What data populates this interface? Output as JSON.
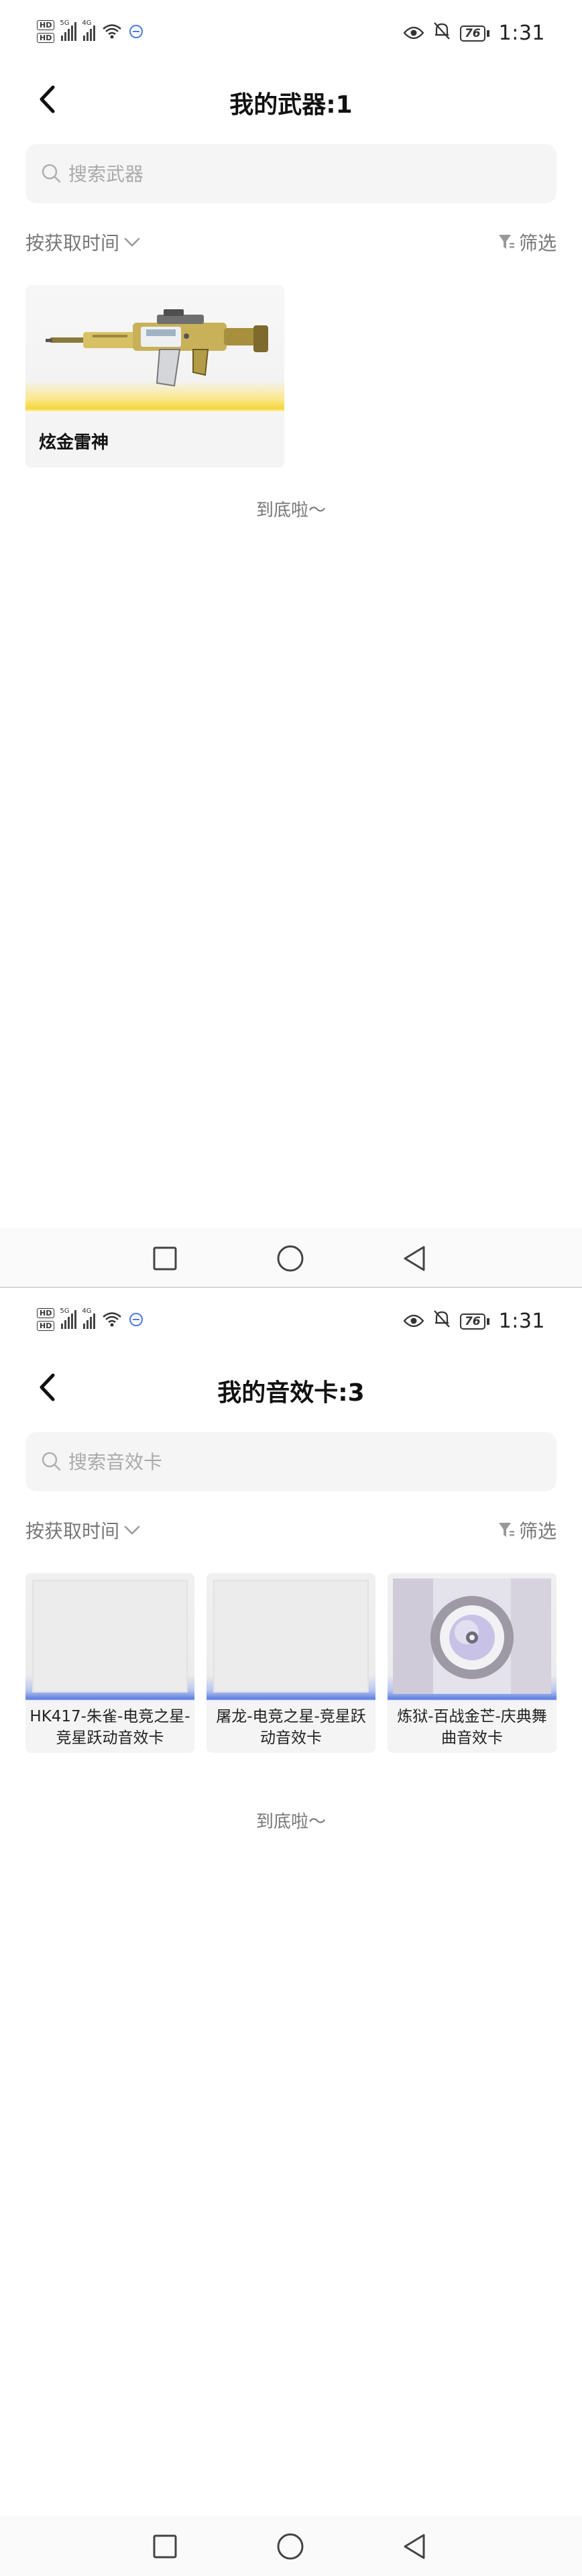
{
  "status_bar": {
    "hd1": "HD",
    "hd2": "HD",
    "net1": "5G",
    "net2": "4G",
    "battery": "76",
    "time": "1:31"
  },
  "screens": [
    {
      "title": "我的武器:1",
      "search_placeholder": "搜索武器",
      "sort_label": "按获取时间",
      "filter_label": "筛选",
      "items": [
        {
          "name": "炫金雷神"
        }
      ],
      "end_text": "到底啦～"
    },
    {
      "title": "我的音效卡:3",
      "search_placeholder": "搜索音效卡",
      "sort_label": "按获取时间",
      "filter_label": "筛选",
      "items": [
        {
          "name": "HK417-朱雀-电竞之星-竞星跃动音效卡"
        },
        {
          "name": "屠龙-电竞之星-竞星跃动音效卡"
        },
        {
          "name": "炼狱-百战金芒-庆典舞曲音效卡"
        }
      ],
      "end_text": "到底啦～"
    }
  ],
  "icons": {
    "back": "chevron-left-icon",
    "search": "search-icon",
    "sort": "chevron-down-icon",
    "filter": "funnel-icon",
    "nav": [
      "square-icon",
      "circle-icon",
      "triangle-back-icon"
    ]
  },
  "colors": {
    "accent_gold": "#f5d53a",
    "accent_blue": "#5a7de0",
    "muted_text": "#777777"
  }
}
